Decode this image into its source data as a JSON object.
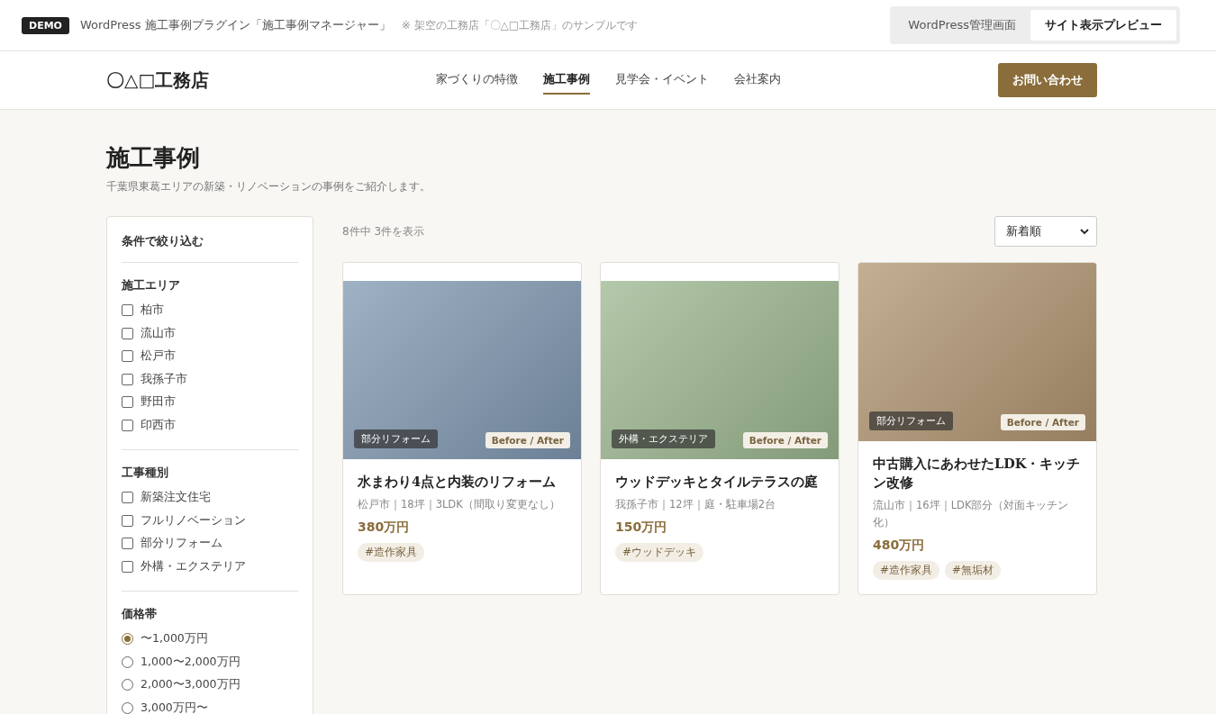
{
  "demo_bar": {
    "badge": "DEMO",
    "title": "WordPress 施工事例プラグイン「施工事例マネージャー」",
    "note": "※ 架空の工務店「〇△□工務店」のサンプルです",
    "tabs": [
      {
        "label": "WordPress管理画面",
        "selected": false
      },
      {
        "label": "サイト表示プレビュー",
        "selected": true
      }
    ]
  },
  "header": {
    "logo": "〇△□工務店",
    "nav": [
      {
        "label": "家づくりの特徴",
        "selected": false
      },
      {
        "label": "施工事例",
        "selected": true
      },
      {
        "label": "見学会・イベント",
        "selected": false
      },
      {
        "label": "会社案内",
        "selected": false
      }
    ],
    "contact_button": "お問い合わせ"
  },
  "page": {
    "title": "施工事例",
    "lead": "千葉県東葛エリアの新築・リノベーションの事例をご紹介します。"
  },
  "filters": {
    "title": "条件で絞り込む",
    "groups": [
      {
        "title": "施工エリア",
        "kind": "checkbox",
        "options": [
          {
            "label": "柏市",
            "checked": false
          },
          {
            "label": "流山市",
            "checked": false
          },
          {
            "label": "松戸市",
            "checked": false
          },
          {
            "label": "我孫子市",
            "checked": false
          },
          {
            "label": "野田市",
            "checked": false
          },
          {
            "label": "印西市",
            "checked": false
          }
        ]
      },
      {
        "title": "工事種別",
        "kind": "checkbox",
        "options": [
          {
            "label": "新築注文住宅",
            "checked": false
          },
          {
            "label": "フルリノベーション",
            "checked": false
          },
          {
            "label": "部分リフォーム",
            "checked": false
          },
          {
            "label": "外構・エクステリア",
            "checked": false
          }
        ]
      },
      {
        "title": "価格帯",
        "kind": "radio",
        "options": [
          {
            "label": "〜1,000万円",
            "checked": true
          },
          {
            "label": "1,000〜2,000万円",
            "checked": false
          },
          {
            "label": "2,000〜3,000万円",
            "checked": false
          },
          {
            "label": "3,000万円〜",
            "checked": false
          }
        ]
      }
    ]
  },
  "results": {
    "count": "8件中 3件を表示",
    "sort": "新着順",
    "cards": [
      {
        "color": "#7f97b0",
        "category": "部分リフォーム",
        "badge": "Before / After",
        "title": "水まわり4点と内装のリフォーム",
        "meta": "松戸市｜18坪｜3LDK（間取り変更なし）",
        "price": "380万円",
        "tags": [
          "#造作家具"
        ]
      },
      {
        "color": "#9bb68e",
        "category": "外構・エクステリア",
        "badge": "Before / After",
        "title": "ウッドデッキとタイルテラスの庭",
        "meta": "我孫子市｜12坪｜庭・駐車場2台",
        "price": "150万円",
        "tags": [
          "#ウッドデッキ"
        ]
      },
      {
        "color": "#b09470",
        "category": "部分リフォーム",
        "badge": "Before / After",
        "title": "中古購入にあわせたLDK・キッチン改修",
        "meta": "流山市｜16坪｜LDK部分（対面キッチン化）",
        "price": "480万円",
        "tags": [
          "#造作家具",
          "#無垢材"
        ]
      }
    ]
  }
}
